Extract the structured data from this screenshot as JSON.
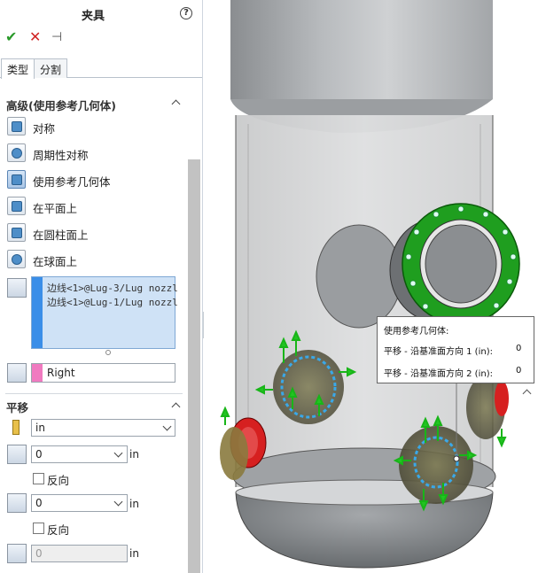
{
  "panel": {
    "title": "夹具",
    "help_icon": "help-circle-icon",
    "ok_icon": "checkmark-icon",
    "cancel_icon": "x-icon",
    "pin_icon": "pushpin-icon",
    "tabs": [
      {
        "label": "类型",
        "active": true
      },
      {
        "label": "分割",
        "active": false
      }
    ],
    "advanced": {
      "heading": "高级(使用参考几何体)",
      "options": [
        {
          "label": "对称",
          "icon": "symmetry-icon",
          "selected": false
        },
        {
          "label": "周期性对称",
          "icon": "cyclic-symmetry-icon",
          "selected": false
        },
        {
          "label": "使用参考几何体",
          "icon": "reference-geometry-icon",
          "selected": true
        },
        {
          "label": "在平面上",
          "icon": "on-flat-face-icon",
          "selected": false
        },
        {
          "label": "在圆柱面上",
          "icon": "on-cylindrical-face-icon",
          "selected": false
        },
        {
          "label": "在球面上",
          "icon": "on-spherical-face-icon",
          "selected": false
        }
      ],
      "selection_items": [
        "边线<1>@Lug-3/Lug nozzl",
        "边线<1>@Lug-1/Lug nozzl"
      ],
      "reference": "Right"
    },
    "translation": {
      "heading": "平移",
      "unit_value": "in",
      "dir1_value": "0",
      "dir1_unit": "in",
      "reverse1_label": "反向",
      "dir2_value": "0",
      "dir2_unit": "in",
      "reverse2_label": "反向",
      "dir3_value": "0",
      "dir3_unit": "in"
    }
  },
  "callout": {
    "title": "使用参考几何体:",
    "row1_label": "平移 - 沿基准面方向 1 (in):",
    "row1_value": "0",
    "row2_label": "平移 - 沿基准面方向 2 (in):",
    "row2_value": "0"
  },
  "colors": {
    "accent_blue": "#3a8ee8",
    "accent_pink": "#f07ac0",
    "flange_green": "#1f9e1f",
    "nozzle_red": "#cc1f1f",
    "arrow_green": "#22c422"
  }
}
